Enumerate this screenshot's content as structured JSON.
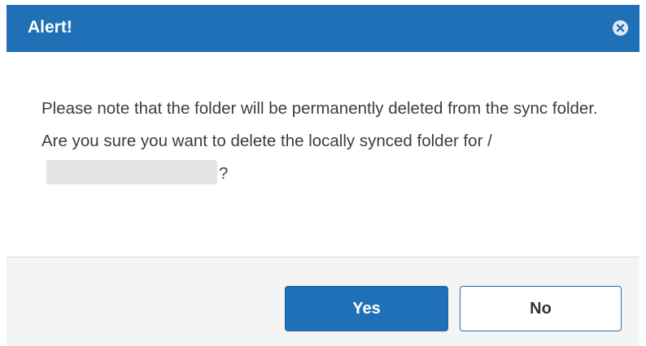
{
  "dialog": {
    "title": "Alert!",
    "message_part1": "Please note that the folder will be permanently deleted from the sync folder. Are you sure you want to delete the locally synced folder for /",
    "message_part2": "?",
    "yes_label": "Yes",
    "no_label": "No",
    "close_icon": "close-circle-icon"
  },
  "colors": {
    "title_bar": "#1f70b6",
    "primary_button": "#1f70b6",
    "footer_background": "#f4f4f4",
    "message_text": "#3c3c3c"
  }
}
